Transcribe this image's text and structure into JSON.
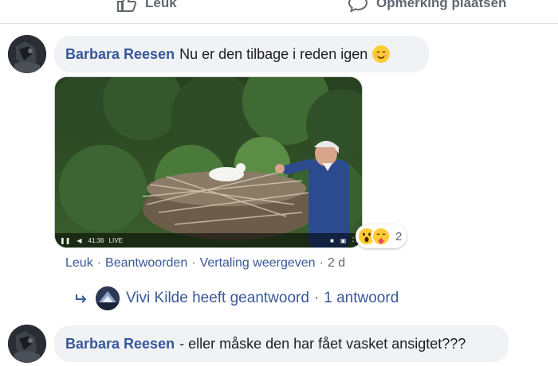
{
  "action_bar": {
    "like_label": "Leuk",
    "comment_label": "Opmerking plaatsen"
  },
  "comment1": {
    "author": "Barbara Reesen",
    "text": "Nu er den tilbage i reden igen",
    "emoji": "smiling-face-icon",
    "video": {
      "time": "41:36",
      "live_label": "LIVE"
    },
    "reactions": {
      "icons": [
        "wow-icon",
        "care-icon"
      ],
      "count": "2"
    },
    "actions": {
      "like": "Leuk",
      "reply": "Beantwoorden",
      "translate": "Vertaling weergeven",
      "time": "2 d"
    },
    "replies": {
      "author": "Vivi Kilde",
      "summary": "Vivi Kilde heeft geantwoord",
      "count_label": "1 antwoord"
    }
  },
  "comment2": {
    "author": "Barbara Reesen",
    "text": "- eller måske den har fået vasket ansigtet???"
  },
  "colors": {
    "link": "#385898",
    "bubble": "#f0f2f5",
    "muted": "#606770"
  }
}
